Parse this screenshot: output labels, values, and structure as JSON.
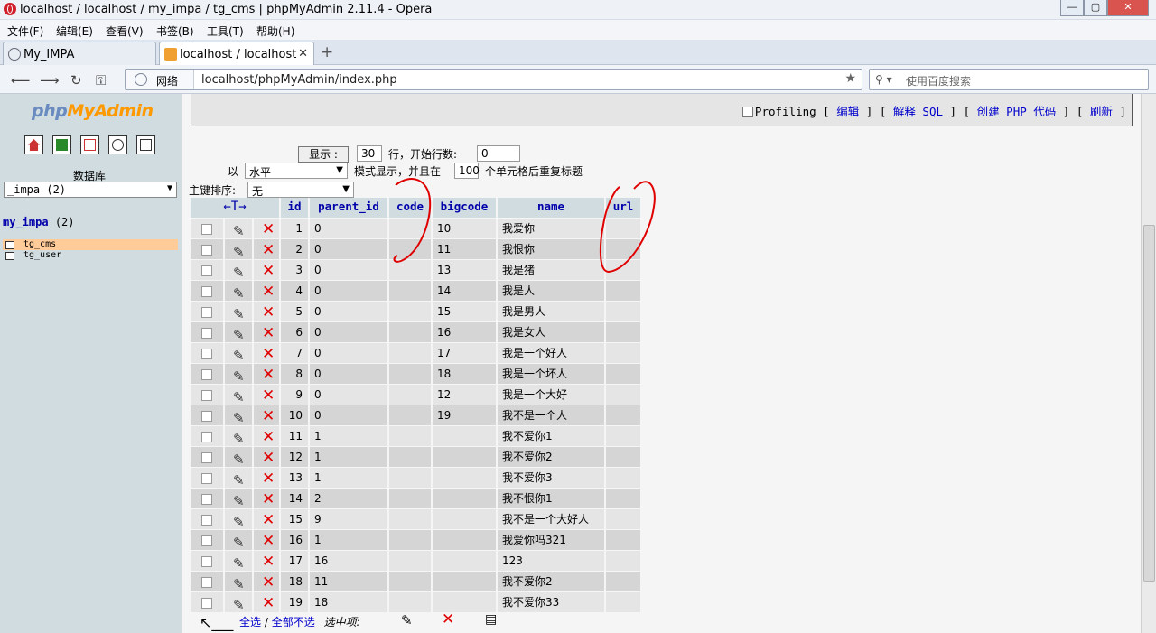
{
  "window": {
    "title": "localhost / localhost / my_impa / tg_cms | phpMyAdmin 2.11.4 - Opera",
    "min": "—",
    "max": "▢",
    "close": "✕"
  },
  "menu": [
    "文件(F)",
    "编辑(E)",
    "查看(V)",
    "书签(B)",
    "工具(T)",
    "帮助(H)"
  ],
  "tabs": [
    {
      "label": "My_IMPA"
    },
    {
      "label": "localhost / localhost ..."
    }
  ],
  "address": {
    "network": "网络",
    "url": "localhost/phpMyAdmin/index.php",
    "search_placeholder": "使用百度搜索"
  },
  "left": {
    "logo_php": "php",
    "logo_myadmin": "MyAdmin",
    "db_label": "数据库",
    "db_select": "_impa (2)",
    "db_name": "my_impa",
    "db_count": "(2)",
    "tables": [
      "tg_cms",
      "tg_user"
    ]
  },
  "top": {
    "profiling": "Profiling",
    "links": [
      "编辑",
      "解释 SQL",
      "创建 PHP 代码",
      "刷新"
    ]
  },
  "controls": {
    "show_btn": "显示 :",
    "rows": "30",
    "rows_label": "行，开始行数:",
    "start": "0",
    "mode_prefix": "以",
    "mode": "水平",
    "mode_label": "模式显示，并且在",
    "repeat": "100",
    "repeat_label": "个单元格后重复标题",
    "sort_label": "主键排序:",
    "sort": "无"
  },
  "table": {
    "arrows": "←T→",
    "columns": [
      "id",
      "parent_id",
      "code",
      "bigcode",
      "name",
      "url"
    ],
    "rows": [
      [
        "1",
        "0",
        "",
        "10",
        "我爱你",
        ""
      ],
      [
        "2",
        "0",
        "",
        "11",
        "我恨你",
        ""
      ],
      [
        "3",
        "0",
        "",
        "13",
        "我是猪",
        ""
      ],
      [
        "4",
        "0",
        "",
        "14",
        "我是人",
        ""
      ],
      [
        "5",
        "0",
        "",
        "15",
        "我是男人",
        ""
      ],
      [
        "6",
        "0",
        "",
        "16",
        "我是女人",
        ""
      ],
      [
        "7",
        "0",
        "",
        "17",
        "我是一个好人",
        ""
      ],
      [
        "8",
        "0",
        "",
        "18",
        "我是一个坏人",
        ""
      ],
      [
        "9",
        "0",
        "",
        "12",
        "我是一个大好",
        ""
      ],
      [
        "10",
        "0",
        "",
        "19",
        "我不是一个人",
        ""
      ],
      [
        "11",
        "1",
        "",
        "",
        "我不爱你1",
        ""
      ],
      [
        "12",
        "1",
        "",
        "",
        "我不爱你2",
        ""
      ],
      [
        "13",
        "1",
        "",
        "",
        "我不爱你3",
        ""
      ],
      [
        "14",
        "2",
        "",
        "",
        "我不恨你1",
        ""
      ],
      [
        "15",
        "9",
        "",
        "",
        "我不是一个大好人",
        ""
      ],
      [
        "16",
        "1",
        "",
        "",
        "我爱你吗321",
        ""
      ],
      [
        "17",
        "16",
        "",
        "",
        "123",
        ""
      ],
      [
        "18",
        "11",
        "",
        "",
        "我不爱你2",
        ""
      ],
      [
        "19",
        "18",
        "",
        "",
        "我不爱你33",
        ""
      ]
    ]
  },
  "footer": {
    "select_all": "全选",
    "sep": "/",
    "deselect_all": "全部不选",
    "with_selected": "选中项:"
  },
  "colors": {
    "left_bg": "#d0dce0",
    "row_odd": "#e5e5e5",
    "row_even": "#d5d5d5",
    "link": "#0000cc",
    "annotation": "#e00000"
  }
}
